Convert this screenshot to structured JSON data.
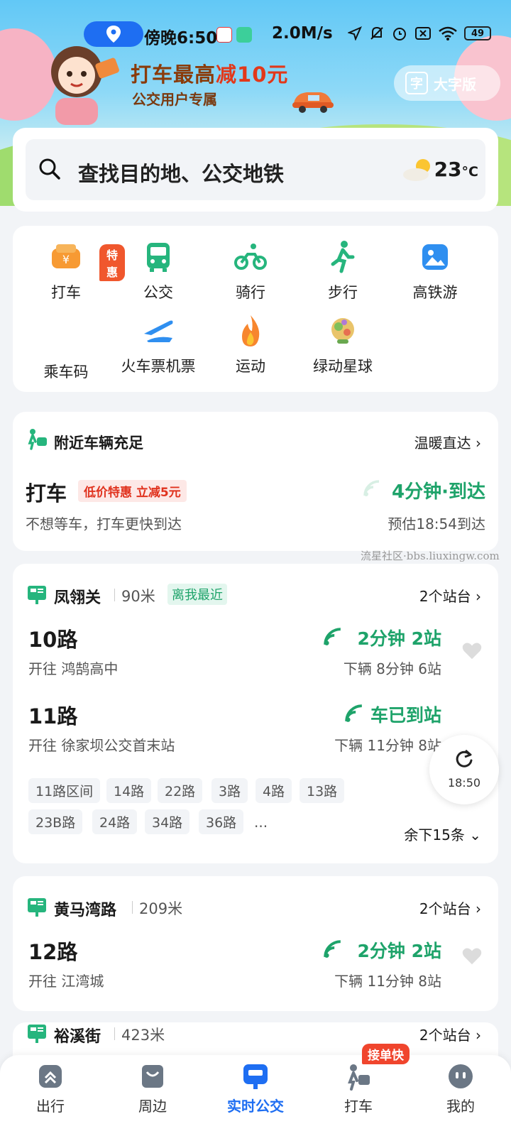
{
  "status_bar": {
    "time": "傍晚6:50",
    "speed": "2.0M/s",
    "battery": "49"
  },
  "promo": {
    "title_prefix": "打车最高",
    "title_accent": "减10元",
    "subtitle": "公交用户专属",
    "big_font": "大字版",
    "big_font_icon": "字"
  },
  "search": {
    "placeholder": "查找目的地、公交地铁",
    "temperature": "23",
    "temp_unit": "°C"
  },
  "services": [
    {
      "label": "打车",
      "badge": "特惠",
      "icon": "taxi-yen-icon"
    },
    {
      "label": "公交",
      "icon": "bus-icon"
    },
    {
      "label": "骑行",
      "icon": "bike-icon"
    },
    {
      "label": "步行",
      "icon": "walk-icon"
    },
    {
      "label": "高铁游",
      "icon": "photo-icon"
    },
    {
      "label": "乘车码",
      "icon": "ride-code-icon"
    },
    {
      "label": "火车票机票",
      "icon": "plane-train-icon"
    },
    {
      "label": "运动",
      "icon": "flame-icon"
    },
    {
      "label": "绿动星球",
      "icon": "planet-icon"
    }
  ],
  "taxi_card": {
    "title": "附近车辆充足",
    "link": "温暖直达",
    "main": "打车",
    "badge": "低价特惠 立减5元",
    "desc": "不想等车，打车更快到达",
    "eta": "4分钟·到达",
    "eta_time": "预估18:54到达"
  },
  "watermark": "流星社区·bbs.liuxingw.com",
  "stop1": {
    "name": "凤翎关",
    "dist": "90米",
    "near": "离我最近",
    "link": "2个站台",
    "routes": [
      {
        "name": "10路",
        "dir": "开往 鸿鹄高中",
        "eta": "2分钟 2站",
        "next": "下辆 8分钟 6站"
      },
      {
        "name": "11路",
        "dir": "开往 徐家坝公交首末站",
        "eta": "车已到站",
        "next": "下辆 11分钟 8站"
      }
    ],
    "chips": [
      "11路区间",
      "14路",
      "22路",
      "3路",
      "4路",
      "13路",
      "23B路",
      "24路",
      "34路",
      "36路",
      "..."
    ],
    "more": "余下15条"
  },
  "refresh_time": "18:50",
  "stop2": {
    "name": "黄马湾路",
    "dist": "209米",
    "link": "2个站台",
    "routes": [
      {
        "name": "12路",
        "dir": "开往 江湾城",
        "eta": "2分钟 2站",
        "next": "下辆 11分钟 8站"
      }
    ]
  },
  "stop3": {
    "name": "裕溪街",
    "dist": "423米",
    "link": "2个站台"
  },
  "tabs": [
    {
      "label": "出行"
    },
    {
      "label": "周边"
    },
    {
      "label": "实时公交",
      "active": true
    },
    {
      "label": "打车",
      "badge": "接单快"
    },
    {
      "label": "我的"
    }
  ]
}
